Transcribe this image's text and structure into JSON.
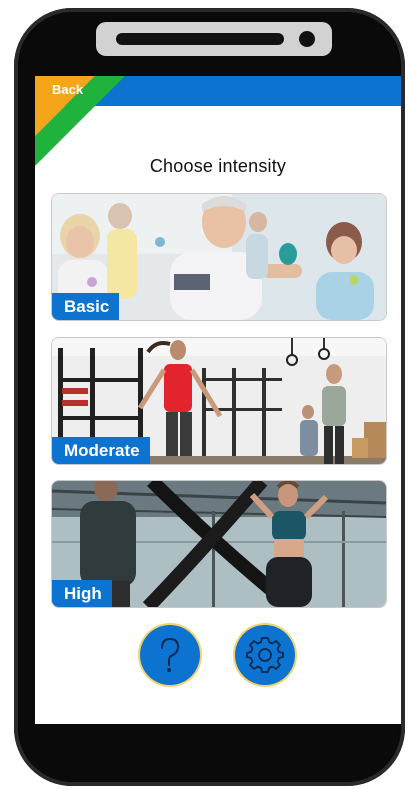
{
  "header": {
    "back_label": "Back"
  },
  "title": "Choose intensity",
  "cards": [
    {
      "label": "Basic"
    },
    {
      "label": "Moderate"
    },
    {
      "label": "High"
    }
  ],
  "colors": {
    "primary_blue": "#0c73d0",
    "stripe_orange": "#f4a51a",
    "stripe_green": "#1fb23c",
    "button_ring": "#f3d36b"
  },
  "icons": {
    "help": "question-mark-icon",
    "settings": "gear-icon"
  }
}
